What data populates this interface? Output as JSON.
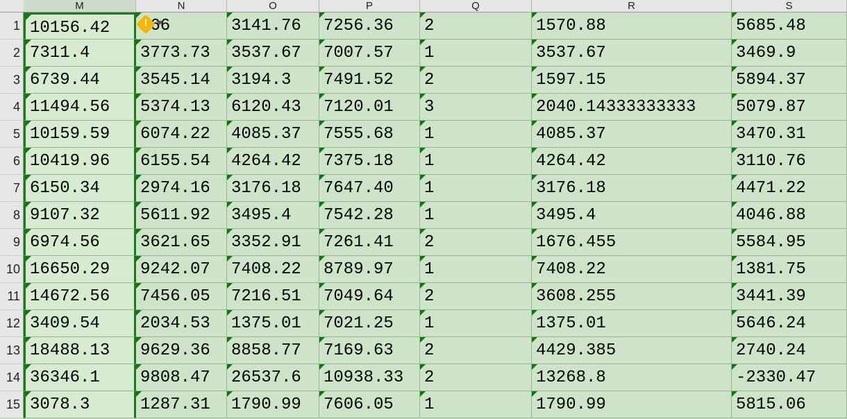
{
  "columns": [
    "M",
    "N",
    "O",
    "P",
    "Q",
    "R",
    "S"
  ],
  "active_column": "M",
  "row_start": 1,
  "rows": [
    {
      "n": 1,
      "M": "10156.42",
      "N": ".66",
      "O": "3141.76",
      "P": "7256.36",
      "Q": "2",
      "R": "1570.88",
      "S": "5685.48"
    },
    {
      "n": 2,
      "M": "7311.4",
      "N": "3773.73",
      "O": "3537.67",
      "P": "7007.57",
      "Q": "1",
      "R": "3537.67",
      "S": "3469.9"
    },
    {
      "n": 3,
      "M": "6739.44",
      "N": "3545.14",
      "O": "3194.3",
      "P": "7491.52",
      "Q": "2",
      "R": "1597.15",
      "S": "5894.37"
    },
    {
      "n": 4,
      "M": "11494.56",
      "N": "5374.13",
      "O": "6120.43",
      "P": "7120.01",
      "Q": "3",
      "R": "2040.14333333333",
      "S": "5079.87"
    },
    {
      "n": 5,
      "M": "10159.59",
      "N": "6074.22",
      "O": "4085.37",
      "P": "7555.68",
      "Q": "1",
      "R": "4085.37",
      "S": "3470.31"
    },
    {
      "n": 6,
      "M": "10419.96",
      "N": "6155.54",
      "O": "4264.42",
      "P": "7375.18",
      "Q": "1",
      "R": "4264.42",
      "S": "3110.76"
    },
    {
      "n": 7,
      "M": "6150.34",
      "N": "2974.16",
      "O": "3176.18",
      "P": "7647.40",
      "Q": "1",
      "R": "3176.18",
      "S": "4471.22"
    },
    {
      "n": 8,
      "M": "9107.32",
      "N": "5611.92",
      "O": "3495.4",
      "P": "7542.28",
      "Q": "1",
      "R": "3495.4",
      "S": "4046.88"
    },
    {
      "n": 9,
      "M": "6974.56",
      "N": "3621.65",
      "O": "3352.91",
      "P": "7261.41",
      "Q": "2",
      "R": "1676.455",
      "S": "5584.95"
    },
    {
      "n": 10,
      "M": "16650.29",
      "N": "9242.07",
      "O": "7408.22",
      "P": "8789.97",
      "Q": "1",
      "R": "7408.22",
      "S": "1381.75"
    },
    {
      "n": 11,
      "M": "14672.56",
      "N": "7456.05",
      "O": "7216.51",
      "P": "7049.64",
      "Q": "2",
      "R": "3608.255",
      "S": "3441.39"
    },
    {
      "n": 12,
      "M": "3409.54",
      "N": "2034.53",
      "O": "1375.01",
      "P": "7021.25",
      "Q": "1",
      "R": "1375.01",
      "S": "5646.24"
    },
    {
      "n": 13,
      "M": "18488.13",
      "N": "9629.36",
      "O": "8858.77",
      "P": "7169.63",
      "Q": "2",
      "R": "4429.385",
      "S": "2740.24"
    },
    {
      "n": 14,
      "M": "36346.1",
      "N": "9808.47",
      "O": "26537.6",
      "P": "10938.33",
      "Q": "2",
      "R": "13268.8",
      "S": "-2330.47"
    },
    {
      "n": 15,
      "M": "3078.3",
      "N": "1287.31",
      "O": "1790.99",
      "P": "7606.05",
      "Q": "1",
      "R": "1790.99",
      "S": "5815.06"
    }
  ],
  "smart_tag": {
    "visible": true
  }
}
